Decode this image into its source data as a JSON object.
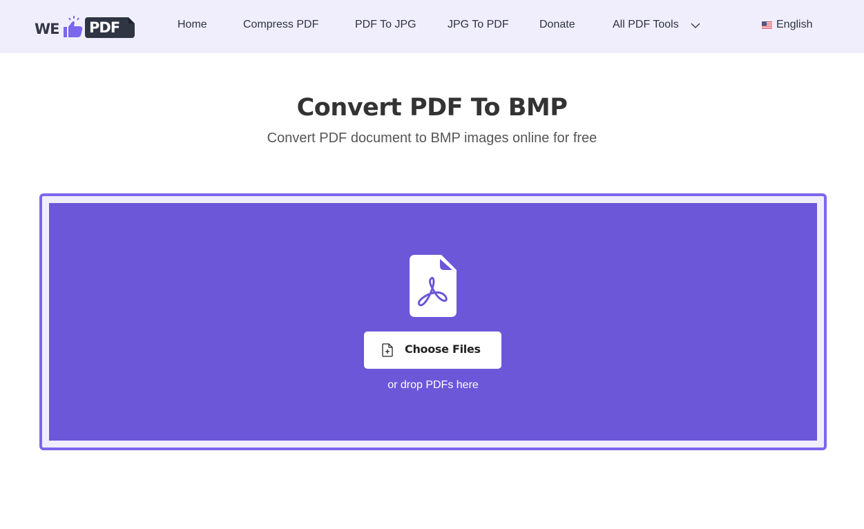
{
  "header": {
    "logo": {
      "left_text": "WE",
      "right_text": "PDF",
      "icon": "thumbs-up-icon"
    },
    "nav": [
      {
        "label": "Home"
      },
      {
        "label": "Compress PDF"
      },
      {
        "label": "PDF To JPG"
      },
      {
        "label": "JPG To PDF"
      },
      {
        "label": "Donate"
      },
      {
        "label": "All PDF Tools",
        "has_dropdown": true,
        "icon": "chevron-down-icon"
      }
    ],
    "language": {
      "label": "English",
      "icon": "us-flag-icon"
    }
  },
  "main": {
    "title": "Convert PDF To BMP",
    "subtitle": "Convert PDF document to BMP images online for free"
  },
  "dropzone": {
    "icon": "pdf-file-icon",
    "button_label": "Choose Files",
    "button_icon": "file-add-icon",
    "hint": "or drop PDFs here"
  },
  "colors": {
    "brand_purple": "#6b57d8",
    "border_purple": "#7b66ee",
    "header_bg": "#f0eefd",
    "logo_dark": "#2f3542"
  }
}
